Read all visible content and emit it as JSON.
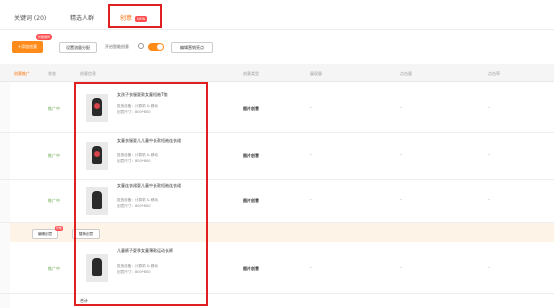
{
  "tabs": [
    {
      "label": "关键词 (20)"
    },
    {
      "label": "精选人群"
    },
    {
      "label": "创意",
      "badge": "NEW"
    }
  ],
  "toolbar": {
    "add_label": "+添加创意",
    "add_tag": "智能推荐",
    "batch_label": "设置流量分配",
    "auto_label": "开启智能创意",
    "auto_enabled": true,
    "edit_label": "编辑营销亮点"
  },
  "table": {
    "headers": [
      "创意推广",
      "状态",
      "创意信息",
      "",
      "创意类型",
      "展现量",
      "点击量",
      "点击率"
    ],
    "rows": [
      {
        "status": "推广中",
        "title": "女孩子衣服夏款女童短袖T恤",
        "meta1": "投放设备：计算机 & 移动",
        "meta2": "创意尺寸：800*800",
        "type": "图片创意",
        "v1": "-",
        "v2": "-",
        "v3": "-"
      },
      {
        "status": "推广中",
        "title": "女童衣服夏儿儿童中长款短袖连衣裙",
        "meta1": "投放设备：计算机 & 移动",
        "meta2": "创意尺寸：800*800",
        "type": "图片创意",
        "v1": "-",
        "v2": "-",
        "v3": "-"
      },
      {
        "status": "推广中",
        "title": "女童连衣裙夏儿童中长款短袖连衣裙",
        "meta1": "投放设备：计算机 & 移动",
        "meta2": "创意尺寸：800*800",
        "type": "图片创意",
        "v1": "-",
        "v2": "-",
        "v3": "-"
      },
      {
        "status": "推广中",
        "title": "儿童裤子夏季女童薄款运动长裤",
        "meta1": "投放设备：计算机 & 移动",
        "meta2": "创意尺寸：800*800",
        "type": "图片创意",
        "v1": "-",
        "v2": "-",
        "v3": "-"
      }
    ],
    "bar_btn1": "编辑创意",
    "bar_btn_tag": "智能",
    "bar_btn2": "替换创意",
    "total_label": "合计"
  }
}
